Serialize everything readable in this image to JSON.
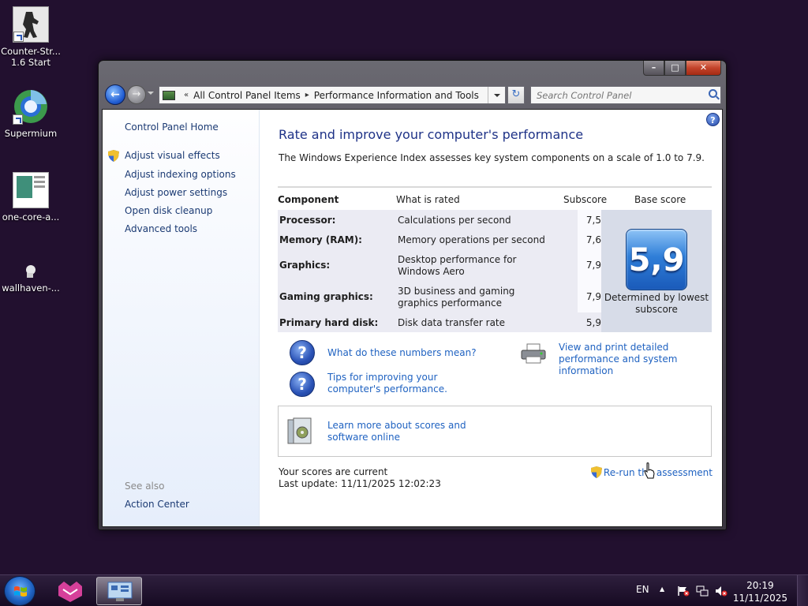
{
  "desktop": {
    "icons": [
      {
        "label_line1": "Counter-Str...",
        "label_line2": "1.6 Start"
      },
      {
        "label_line1": "Supermium",
        "label_line2": ""
      },
      {
        "label_line1": "one-core-a...",
        "label_line2": ""
      },
      {
        "label_line1": "wallhaven-...",
        "label_line2": ""
      }
    ]
  },
  "window": {
    "caption": {
      "min": "–",
      "max": "□",
      "close": "✕"
    },
    "address": {
      "sep": "«",
      "crumb1": "All Control Panel Items",
      "arrow": "▸",
      "crumb2": "Performance Information and Tools"
    },
    "refresh_glyph": "↻",
    "search_placeholder": "Search Control Panel"
  },
  "sidebar": {
    "home": "Control Panel Home",
    "links": [
      "Adjust visual effects",
      "Adjust indexing options",
      "Adjust power settings",
      "Open disk cleanup",
      "Advanced tools"
    ],
    "see_also": "See also",
    "action_center": "Action Center"
  },
  "main": {
    "help": "?",
    "title": "Rate and improve your computer's performance",
    "intro": "The Windows Experience Index assesses key system components on a scale of 1.0 to 7.9.",
    "table": {
      "headers": {
        "component": "Component",
        "rated": "What is rated",
        "subscore": "Subscore",
        "base": "Base score"
      },
      "rows": [
        {
          "component": "Processor:",
          "rated": "Calculations per second",
          "subscore": "7,5"
        },
        {
          "component": "Memory (RAM):",
          "rated": "Memory operations per second",
          "subscore": "7,6"
        },
        {
          "component": "Graphics:",
          "rated": "Desktop performance for Windows Aero",
          "subscore": "7,9"
        },
        {
          "component": "Gaming graphics:",
          "rated": "3D business and gaming graphics performance",
          "subscore": "7,9"
        },
        {
          "component": "Primary hard disk:",
          "rated": "Disk data transfer rate",
          "subscore": "5,9"
        }
      ],
      "base_score": "5,9",
      "base_note": "Determined by lowest subscore"
    },
    "links": {
      "numbers": "What do these numbers mean?",
      "tips": "Tips for improving your computer's performance.",
      "print": "View and print detailed performance and system information",
      "learn": "Learn more about scores and software online"
    },
    "status": {
      "current": "Your scores are current",
      "last_update": "Last update: 11/11/2025 12:02:23"
    },
    "rerun": "Re-run the assessment"
  },
  "taskbar": {
    "lang": "EN",
    "tray_arrow": "▲",
    "time": "20:19",
    "date": "11/11/2025"
  },
  "colors": {
    "desktop_bg": "#22102f",
    "link": "#1f62c1",
    "title": "#1e3287",
    "sidebar_link": "#1b3a73"
  }
}
